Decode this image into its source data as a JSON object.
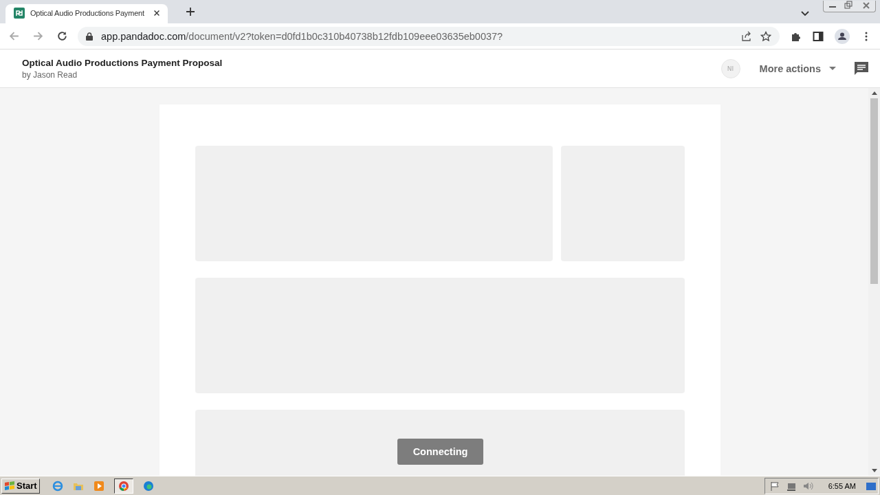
{
  "browser": {
    "tab": {
      "title": "Optical Audio Productions Payment",
      "selected": true
    },
    "address": {
      "host": "app.pandadoc.com",
      "path": "/document/v2?token=d0fd1b0c310b40738b12fdb109eee03635eb0037?"
    }
  },
  "header": {
    "title": "Optical Audio Productions Payment Proposal",
    "author": "by Jason Read",
    "avatar": "NI",
    "more_actions": "More actions"
  },
  "toast": "Connecting",
  "taskbar": {
    "start": "Start",
    "clock": "6:55 AM"
  }
}
